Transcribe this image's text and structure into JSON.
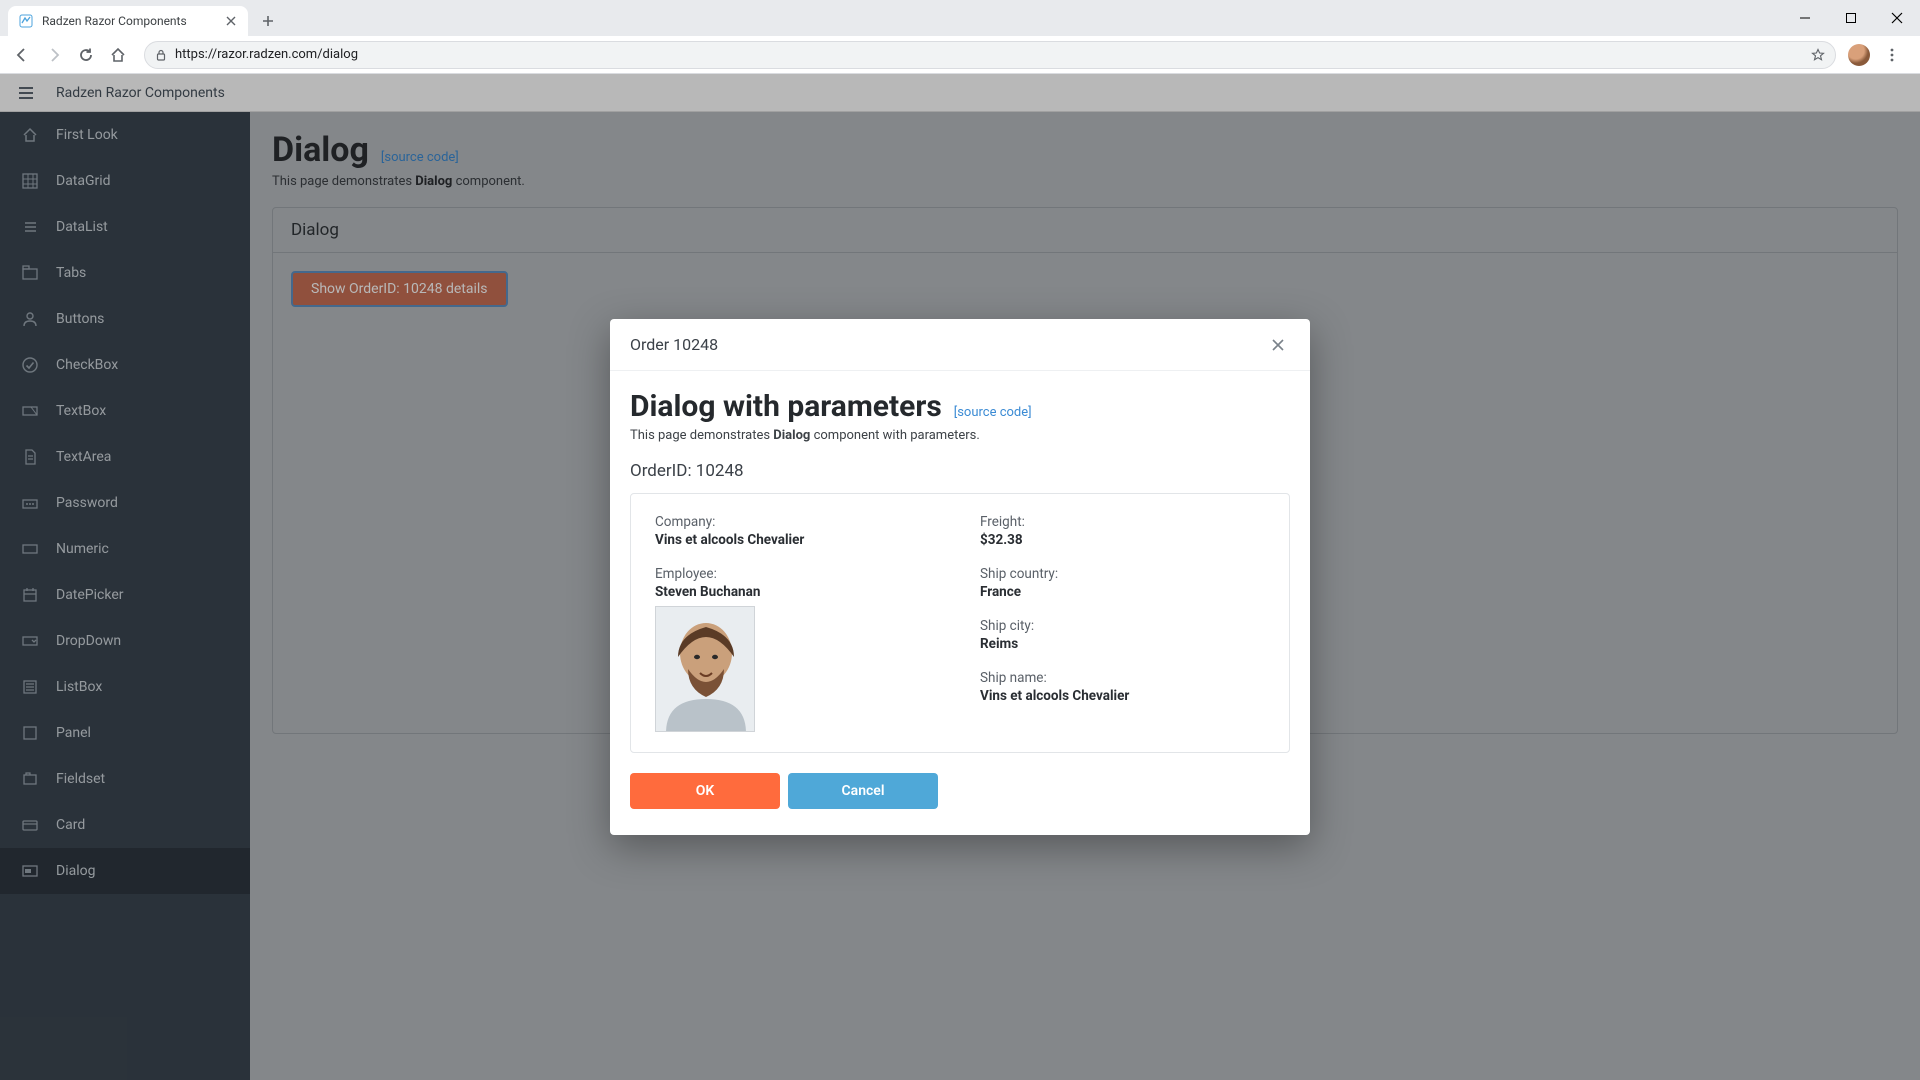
{
  "browser": {
    "tab_title": "Radzen Razor Components",
    "url": "https://razor.radzen.com/dialog"
  },
  "app": {
    "title": "Radzen Razor Components"
  },
  "page": {
    "title": "Dialog",
    "source_link": "[source code]",
    "subtitle_pre": "This page demonstrates ",
    "subtitle_bold": "Dialog",
    "subtitle_post": " component.",
    "panel_title": "Dialog",
    "show_button": "Show OrderID: 10248 details"
  },
  "sidebar": {
    "items": [
      {
        "icon": "home",
        "label": "First Look"
      },
      {
        "icon": "grid",
        "label": "DataGrid"
      },
      {
        "icon": "list",
        "label": "DataList"
      },
      {
        "icon": "tabs",
        "label": "Tabs"
      },
      {
        "icon": "user",
        "label": "Buttons"
      },
      {
        "icon": "check",
        "label": "CheckBox"
      },
      {
        "icon": "textbox",
        "label": "TextBox"
      },
      {
        "icon": "doc",
        "label": "TextArea"
      },
      {
        "icon": "key",
        "label": "Password"
      },
      {
        "icon": "num",
        "label": "Numeric"
      },
      {
        "icon": "date",
        "label": "DatePicker"
      },
      {
        "icon": "drop",
        "label": "DropDown"
      },
      {
        "icon": "listbox",
        "label": "ListBox"
      },
      {
        "icon": "panel",
        "label": "Panel"
      },
      {
        "icon": "fieldset",
        "label": "Fieldset"
      },
      {
        "icon": "card",
        "label": "Card"
      },
      {
        "icon": "dialog",
        "label": "Dialog"
      }
    ],
    "active_index": 16
  },
  "dialog": {
    "title": "Order 10248",
    "heading": "Dialog with parameters",
    "source_link": "[source code]",
    "subtitle_pre": "This page demonstrates ",
    "subtitle_bold": "Dialog",
    "subtitle_post": " component with parameters.",
    "order_line": "OrderID: 10248",
    "left": {
      "company_label": "Company:",
      "company_value": "Vins et alcools Chevalier",
      "employee_label": "Employee:",
      "employee_value": "Steven Buchanan"
    },
    "right": {
      "freight_label": "Freight:",
      "freight_value": "$32.38",
      "ship_country_label": "Ship country:",
      "ship_country_value": "France",
      "ship_city_label": "Ship city:",
      "ship_city_value": "Reims",
      "ship_name_label": "Ship name:",
      "ship_name_value": "Vins et alcools Chevalier"
    },
    "ok": "OK",
    "cancel": "Cancel"
  }
}
